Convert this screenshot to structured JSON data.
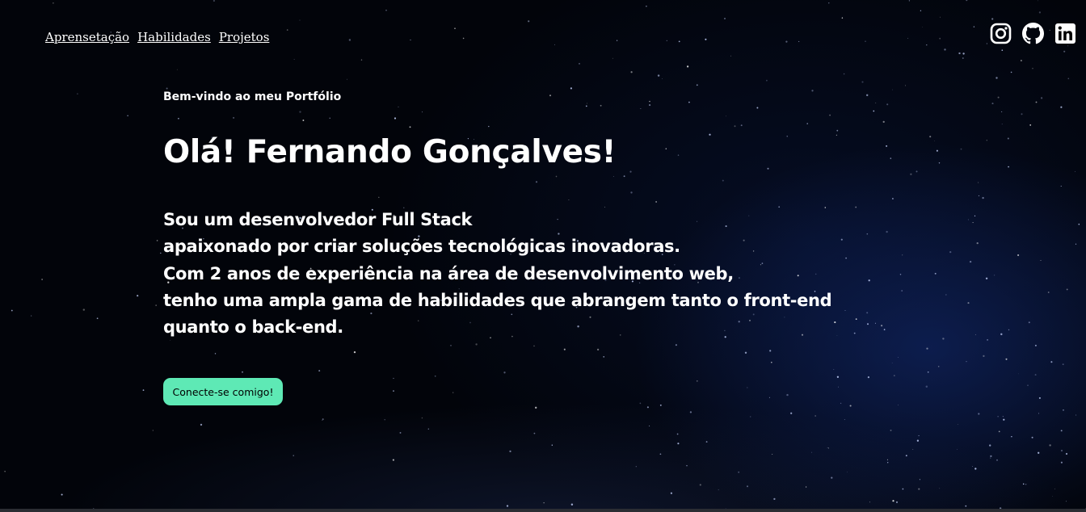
{
  "nav": {
    "links": [
      {
        "label": "Aprensetação"
      },
      {
        "label": "Habilidades"
      },
      {
        "label": "Projetos"
      }
    ]
  },
  "social": {
    "icons": [
      "instagram-icon",
      "github-icon",
      "linkedin-icon"
    ]
  },
  "hero": {
    "welcome": "Bem-vindo ao meu Portfólio",
    "title": "Olá! Fernando Gonçalves!",
    "bio_lines": [
      "Sou um desenvolvedor Full Stack",
      "apaixonado por criar soluções tecnológicas inovadoras.",
      "Com 2 anos de experiência na área de desenvolvimento web,",
      "tenho uma ampla gama de habilidades que abrangem tanto o front-end",
      "quanto o back-end."
    ],
    "cta_label": "Conecte-se comigo!"
  },
  "colors": {
    "background": "#000000",
    "text": "#ffffff",
    "cta_background": "#5ee9b5",
    "cta_text": "#000000"
  }
}
